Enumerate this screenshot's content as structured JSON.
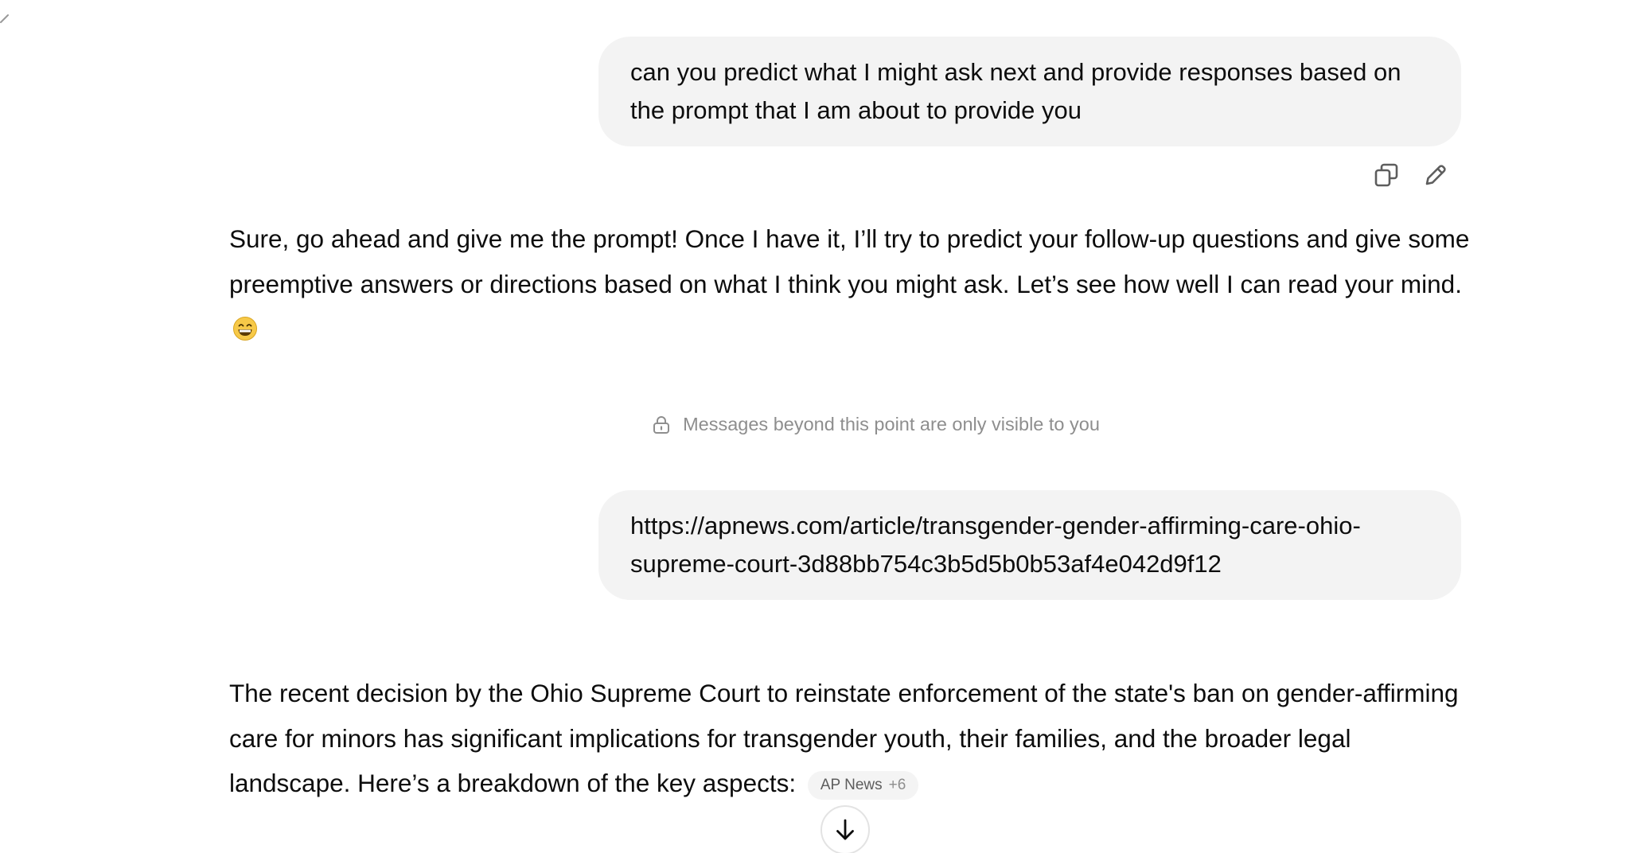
{
  "conversation": {
    "messages": [
      {
        "role": "user",
        "text": "can you predict what I might ask next and provide responses based on the prompt that I am about to provide you"
      },
      {
        "role": "assistant",
        "text": "Sure, go ahead and give me the prompt! Once I have it, I’ll try to predict your follow-up questions and give some preemptive answers or directions based on what I think you might ask. Let’s see how well I can read your mind.",
        "emoji": "grinning-face-with-smiling-eyes"
      },
      {
        "role": "user",
        "text": "https://apnews.com/article/transgender-gender-affirming-care-ohio-supreme-court-3d88bb754c3b5d5b0b53af4e042d9f12"
      },
      {
        "role": "assistant",
        "text": "The recent decision by the Ohio Supreme Court to reinstate enforcement of the state's ban on gender-affirming care for minors has significant implications for transgender youth, their families, and the broader legal landscape. Here’s a breakdown of the key aspects:",
        "citation": {
          "source": "AP News",
          "extra": "+6"
        }
      }
    ],
    "privacy_notice": "Messages beyond this point are only visible to you"
  },
  "icons": {
    "copy": "copy-icon",
    "edit": "pencil-icon",
    "lock": "lock-icon",
    "scroll": "arrow-down-icon"
  },
  "colors": {
    "user_bubble_bg": "#f3f3f3",
    "text": "#0d0d0d",
    "muted_text": "#8e8e8e",
    "pill_bg": "#f4f4f4"
  }
}
